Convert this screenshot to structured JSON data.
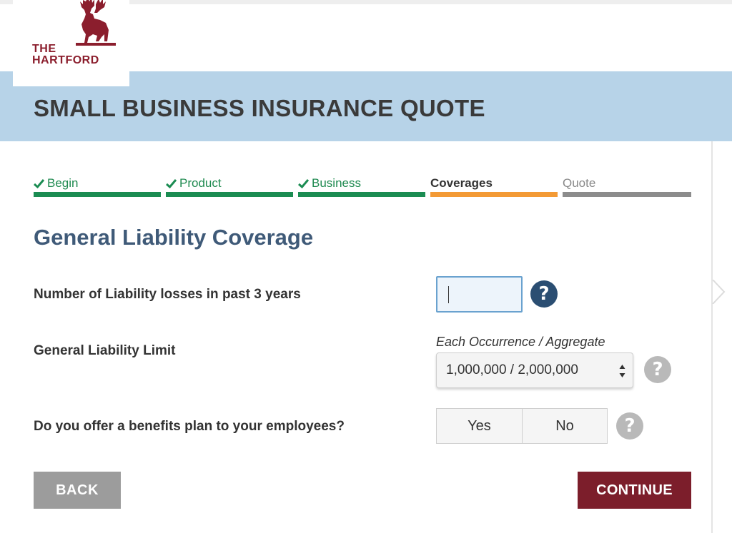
{
  "brand": {
    "logo_line1": "THE",
    "logo_line2": "HARTFORD"
  },
  "header": {
    "title": "SMALL BUSINESS INSURANCE QUOTE"
  },
  "progress": {
    "steps": [
      {
        "label": "Begin",
        "status": "complete"
      },
      {
        "label": "Product",
        "status": "complete"
      },
      {
        "label": "Business",
        "status": "complete"
      },
      {
        "label": "Coverages",
        "status": "current"
      },
      {
        "label": "Quote",
        "status": "upcoming"
      }
    ]
  },
  "section": {
    "title": "General Liability Coverage"
  },
  "questions": {
    "losses": {
      "label": "Number of Liability losses in past 3 years",
      "value": ""
    },
    "limit": {
      "label": "General Liability Limit",
      "caption": "Each Occurrence / Aggregate",
      "selected": "1,000,000 / 2,000,000"
    },
    "benefits": {
      "label": "Do you offer a benefits plan to your employees?",
      "yes": "Yes",
      "no": "No"
    }
  },
  "help_icon_glyph": "?",
  "actions": {
    "back": "BACK",
    "continue": "CONTINUE"
  },
  "colors": {
    "banner": "#b7d3e8",
    "complete": "#1b8c52",
    "current": "#f39a35",
    "upcoming": "#8c8c8c",
    "continue": "#7c1e2b",
    "brand": "#8b1e2d"
  }
}
